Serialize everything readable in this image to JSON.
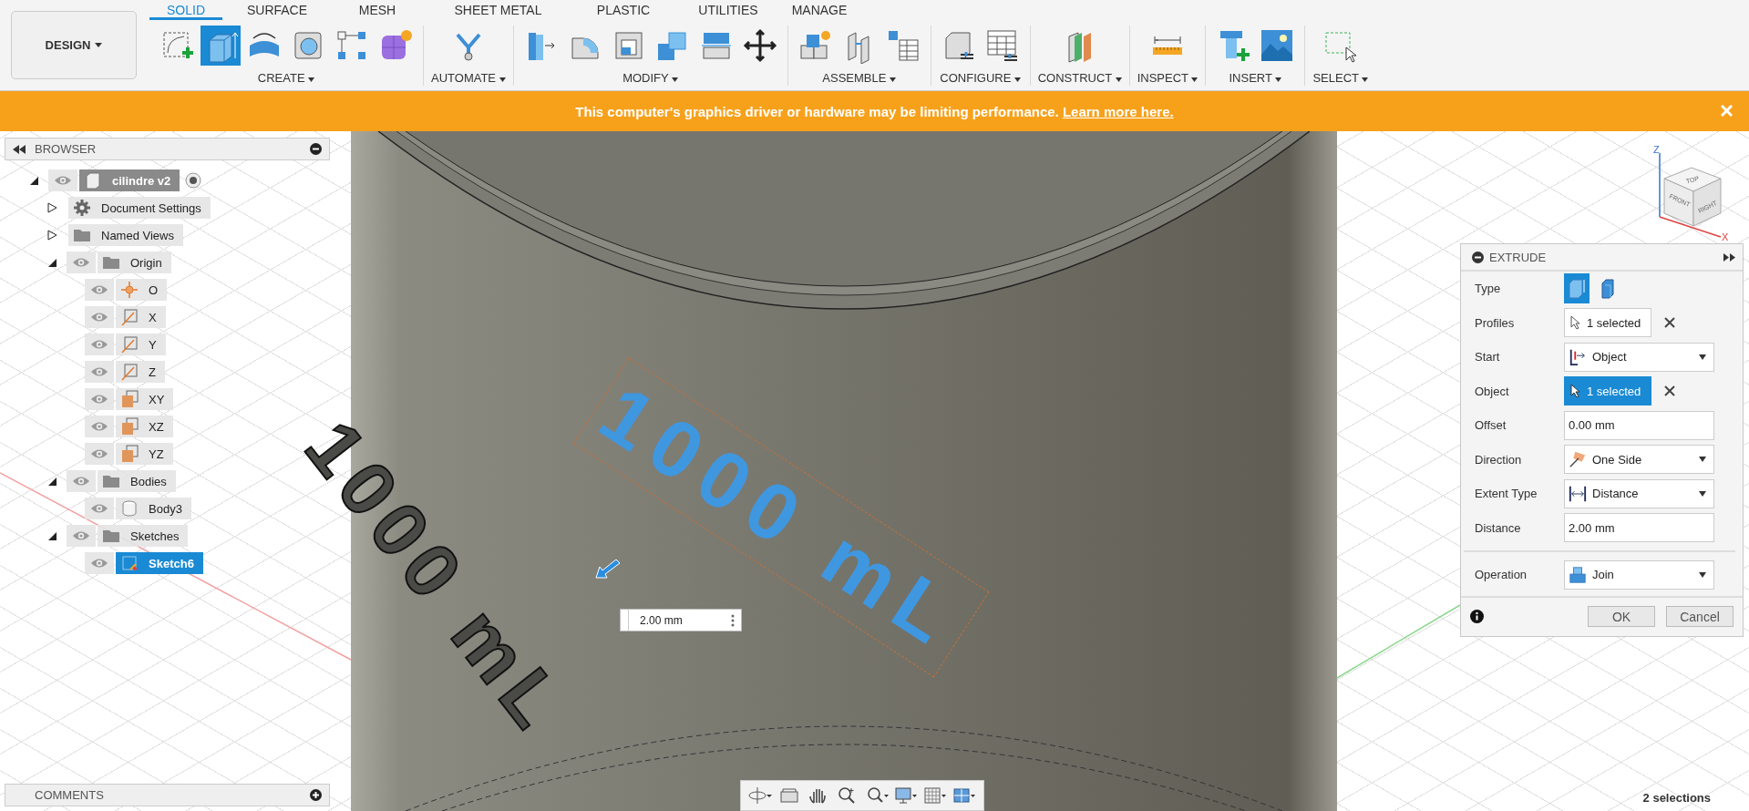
{
  "toolbar": {
    "workspace": "DESIGN",
    "tabs": [
      {
        "label": "SOLID",
        "selected": true
      },
      {
        "label": "SURFACE",
        "selected": false
      },
      {
        "label": "MESH",
        "selected": false
      },
      {
        "label": "SHEET METAL",
        "selected": false
      },
      {
        "label": "PLASTIC",
        "selected": false
      },
      {
        "label": "UTILITIES",
        "selected": false
      },
      {
        "label": "MANAGE",
        "selected": false
      }
    ],
    "groups": [
      {
        "label": "CREATE",
        "tools": [
          {
            "kind": "sketch",
            "selected": false
          },
          {
            "kind": "extrude",
            "selected": true
          },
          {
            "kind": "revolve",
            "selected": false
          },
          {
            "kind": "hole",
            "selected": false
          },
          {
            "kind": "pattern",
            "selected": false
          },
          {
            "kind": "form",
            "selected": false
          }
        ]
      },
      {
        "label": "AUTOMATE",
        "tools": [
          {
            "kind": "automate",
            "selected": false
          }
        ]
      },
      {
        "label": "MODIFY",
        "tools": [
          {
            "kind": "presspull",
            "selected": false
          },
          {
            "kind": "fillet",
            "selected": false
          },
          {
            "kind": "shell",
            "selected": false
          },
          {
            "kind": "combine",
            "selected": false
          },
          {
            "kind": "split",
            "selected": false
          },
          {
            "kind": "move",
            "selected": false
          }
        ]
      },
      {
        "label": "ASSEMBLE",
        "tools": [
          {
            "kind": "component",
            "selected": false
          },
          {
            "kind": "joint",
            "selected": false
          },
          {
            "kind": "table",
            "selected": false
          }
        ]
      },
      {
        "label": "CONFIGURE",
        "tools": [
          {
            "kind": "configure",
            "selected": false
          },
          {
            "kind": "configtable",
            "selected": false
          }
        ]
      },
      {
        "label": "CONSTRUCT",
        "tools": [
          {
            "kind": "plane",
            "selected": false
          }
        ]
      },
      {
        "label": "INSPECT",
        "tools": [
          {
            "kind": "measure",
            "selected": false
          }
        ]
      },
      {
        "label": "INSERT",
        "tools": [
          {
            "kind": "bolt",
            "selected": false
          },
          {
            "kind": "image",
            "selected": false
          }
        ]
      },
      {
        "label": "SELECT",
        "tools": [
          {
            "kind": "select",
            "selected": false
          }
        ]
      }
    ]
  },
  "banner": {
    "message": "This computer's graphics driver or hardware may be limiting performance.",
    "link": "Learn more here."
  },
  "browser": {
    "title": "BROWSER",
    "tree": [
      {
        "label": "cilindre v2",
        "kind": "component",
        "expanded": true,
        "visible": true,
        "selected": false,
        "children": [
          {
            "label": "Document Settings",
            "kind": "settings",
            "expanded": false,
            "selected": false
          },
          {
            "label": "Named Views",
            "kind": "folder",
            "expanded": false,
            "selected": false
          },
          {
            "label": "Origin",
            "kind": "folder",
            "expanded": true,
            "visible": true,
            "selected": false,
            "children": [
              {
                "label": "O",
                "kind": "point",
                "visible": true,
                "selected": false
              },
              {
                "label": "X",
                "kind": "axis",
                "visible": true,
                "selected": false
              },
              {
                "label": "Y",
                "kind": "axis",
                "visible": true,
                "selected": false
              },
              {
                "label": "Z",
                "kind": "axis",
                "visible": true,
                "selected": false
              },
              {
                "label": "XY",
                "kind": "plane",
                "visible": true,
                "selected": false
              },
              {
                "label": "XZ",
                "kind": "plane",
                "visible": true,
                "selected": false
              },
              {
                "label": "YZ",
                "kind": "plane",
                "visible": true,
                "selected": false
              }
            ]
          },
          {
            "label": "Bodies",
            "kind": "folder",
            "expanded": true,
            "visible": true,
            "selected": false,
            "children": [
              {
                "label": "Body3",
                "kind": "body",
                "visible": true,
                "selected": false
              }
            ]
          },
          {
            "label": "Sketches",
            "kind": "folder",
            "expanded": true,
            "visible": true,
            "selected": false,
            "children": [
              {
                "label": "Sketch6",
                "kind": "sketch",
                "visible": true,
                "selected": true
              }
            ]
          }
        ]
      }
    ]
  },
  "viewport": {
    "sketch_text": "1000 mL",
    "extruded_text": "1000 mL",
    "dimension": "2.00 mm",
    "view_cube": {
      "faces": [
        "TOP",
        "FRONT",
        "RIGHT"
      ],
      "axes": [
        "Z",
        "X"
      ]
    }
  },
  "extrude": {
    "title": "EXTRUDE",
    "rows": [
      {
        "kind": "type",
        "label": "Type",
        "options": [
          {
            "selected": true
          },
          {
            "selected": false
          }
        ]
      },
      {
        "kind": "selection",
        "label": "Profiles",
        "value": "1 selected",
        "active": false
      },
      {
        "kind": "dropdown",
        "label": "Start",
        "value": "Object"
      },
      {
        "kind": "selection",
        "label": "Object",
        "value": "1 selected",
        "active": true
      },
      {
        "kind": "input",
        "label": "Offset",
        "value": "0.00 mm"
      },
      {
        "kind": "dropdown",
        "label": "Direction",
        "value": "One Side"
      },
      {
        "kind": "dropdown",
        "label": "Extent Type",
        "value": "Distance"
      },
      {
        "kind": "input",
        "label": "Distance",
        "value": "2.00 mm"
      }
    ],
    "operation": {
      "kind": "dropdown",
      "label": "Operation",
      "value": "Join"
    },
    "buttons": [
      "OK",
      "Cancel"
    ]
  },
  "comments": {
    "title": "COMMENTS"
  },
  "status": "2 selections"
}
